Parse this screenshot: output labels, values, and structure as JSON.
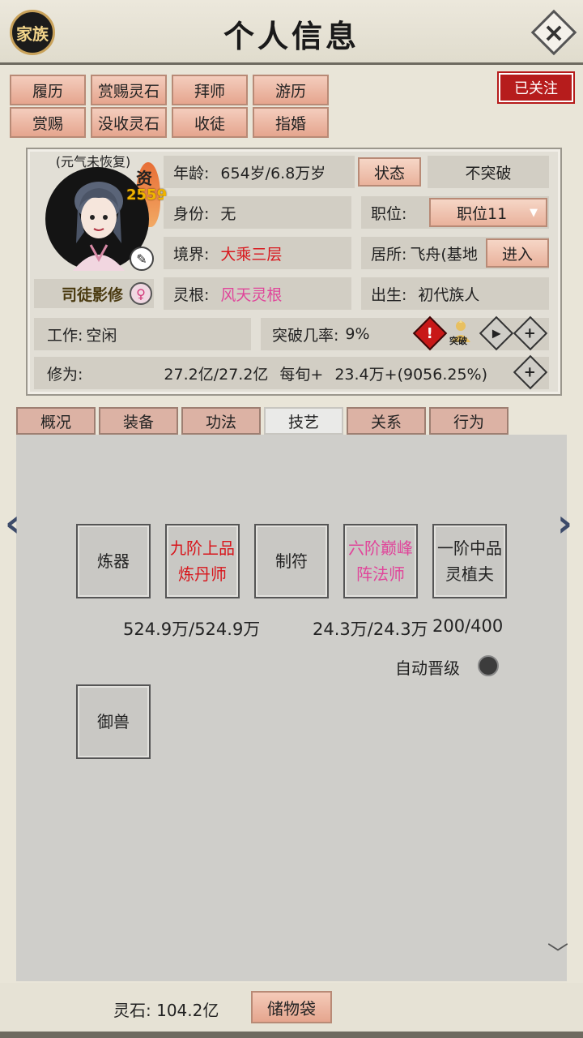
{
  "header": {
    "family_label": "家族",
    "title": "个人信息",
    "close_glyph": "×"
  },
  "actions": {
    "row1": [
      "履历",
      "赏赐灵石",
      "拜师",
      "游历"
    ],
    "row2": [
      "赏赐",
      "没收灵石",
      "收徒",
      "指婚"
    ],
    "follow_label": "已关注"
  },
  "profile": {
    "avatar_status": "(元气未恢复)",
    "talent_label": "资",
    "talent_value": "2559",
    "name": "司徒影修",
    "gender_glyph": "♀",
    "age_label": "年龄:",
    "age_value": "654岁/6.8万岁",
    "status_button": "状态",
    "no_breakthrough": "不突破",
    "identity_label": "身份:",
    "identity_value": "无",
    "position_label": "职位:",
    "position_value": "职位11",
    "realm_label": "境界:",
    "realm_value": "大乘三层",
    "residence_label": "居所:",
    "residence_value": "飞舟(基地",
    "enter_button": "进入",
    "root_label": "灵根:",
    "root_value": "风天灵根",
    "birth_label": "出生:",
    "birth_value": "初代族人",
    "work_label": "工作:",
    "work_value": "空闲",
    "breakthrough_label": "突破几率:",
    "breakthrough_value": "9%",
    "breakthrough_icon_text": "突破",
    "cultivation_label": "修为:",
    "cultivation_value": "27.2亿/27.2亿",
    "per_turn_label": "每旬+",
    "per_turn_value": "23.4万+(9056.25%)"
  },
  "tabs": [
    "概况",
    "装备",
    "功法",
    "技艺",
    "关系",
    "行为"
  ],
  "active_tab": "技艺",
  "skills": {
    "items": [
      {
        "label": "炼器",
        "color": "#222222"
      },
      {
        "label": "九阶上品炼丹师",
        "color": "#d8161c"
      },
      {
        "label": "制符",
        "color": "#222222"
      },
      {
        "label": "六阶巅峰阵法师",
        "color": "#e0459a"
      },
      {
        "label": "一阶中品灵植夫",
        "color": "#222222"
      },
      {
        "label": "御兽",
        "color": "#222222"
      }
    ],
    "progress": [
      "524.9万/524.9万",
      "24.3万/24.3万",
      "200/400"
    ],
    "auto_upgrade_label": "自动晋级"
  },
  "footer": {
    "spirit_stone_label": "灵石:",
    "spirit_stone_value": "104.2亿",
    "bag_label": "储物袋"
  },
  "colors": {
    "accent_pink": "#e5a58e",
    "follow_red": "#b61c1c",
    "realm_red": "#d8161c",
    "root_pink": "#e0459a"
  }
}
